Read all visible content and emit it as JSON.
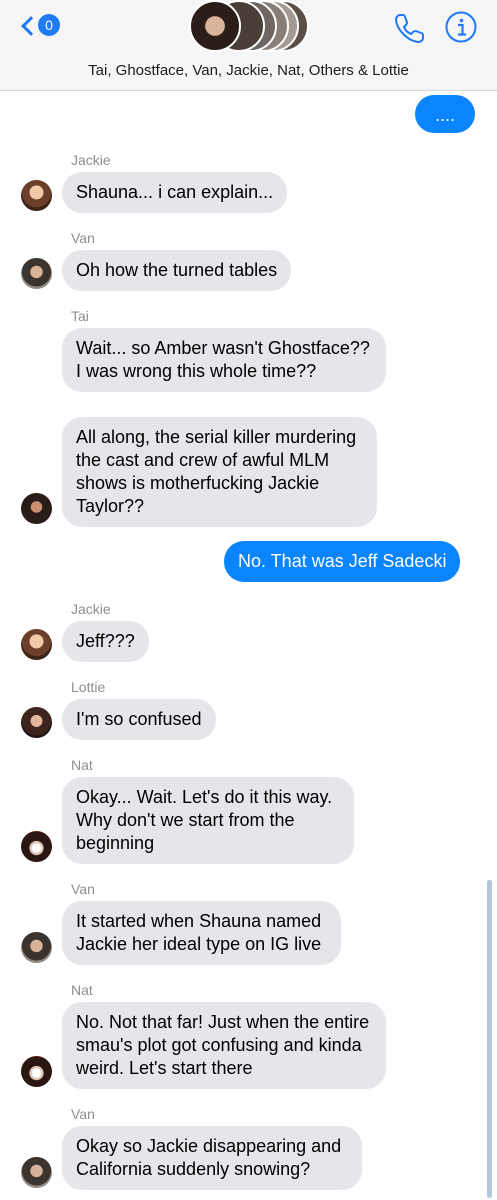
{
  "header": {
    "back_count": "0",
    "title": "Tai, Ghostface, Van, Jackie, Nat, Others & Lottie",
    "stack_colors": [
      "#2b1e18",
      "#4a3f38",
      "#6e6660",
      "#8a7f78",
      "#a39a94",
      "#5a4e47"
    ]
  },
  "messages": [
    {
      "type": "out",
      "text": "...."
    },
    {
      "type": "in",
      "sender": "Jackie",
      "avatar": "jackie",
      "text": "Shauna... i can explain..."
    },
    {
      "type": "in",
      "sender": "Van",
      "avatar": "van",
      "text": "Oh how the turned tables"
    },
    {
      "type": "in",
      "sender": "Tai",
      "text": "Wait... so Amber wasn't Ghostface?? I was wrong this whole time??"
    },
    {
      "type": "in",
      "avatar": "tai",
      "text": "All along, the serial killer murdering the cast and crew of awful MLM shows is motherfucking Jackie Taylor??"
    },
    {
      "type": "out",
      "text": "No. That was Jeff Sadecki"
    },
    {
      "type": "in",
      "sender": "Jackie",
      "avatar": "jackie",
      "text": "Jeff???"
    },
    {
      "type": "in",
      "sender": "Lottie",
      "avatar": "lottie",
      "text": "I'm so confused"
    },
    {
      "type": "in",
      "sender": "Nat",
      "avatar": "nat",
      "text": "Okay... Wait. Let's do it this way. Why don't we start from the beginning"
    },
    {
      "type": "in",
      "sender": "Van",
      "avatar": "van",
      "text": "It started when Shauna named Jackie her ideal type on IG live"
    },
    {
      "type": "in",
      "sender": "Nat",
      "avatar": "nat",
      "text": "No. Not that far! Just when the entire smau's plot got confusing and kinda weird. Let's start there"
    },
    {
      "type": "in",
      "sender": "Van",
      "avatar": "van",
      "text": "Okay so Jackie disappearing and California suddenly snowing?"
    }
  ]
}
